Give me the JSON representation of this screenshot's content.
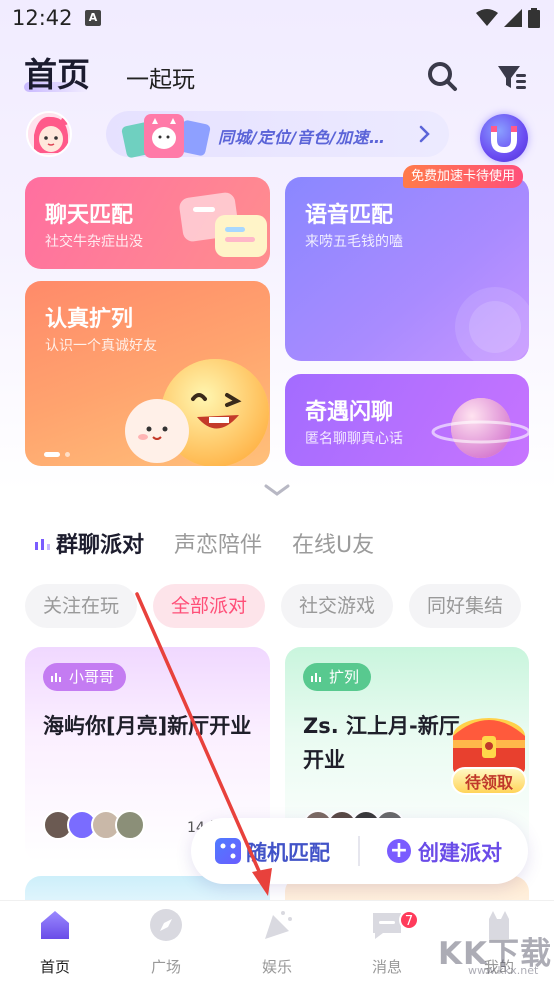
{
  "status_bar": {
    "time": "12:42",
    "notif_glyph": "A"
  },
  "header": {
    "tabs": [
      {
        "label": "首页",
        "active": true
      },
      {
        "label": "一起玩",
        "active": false
      }
    ],
    "icons": [
      "search-icon",
      "filter-icon"
    ]
  },
  "banner": {
    "text": "同城/定位/音色/加速…"
  },
  "feature_cards": {
    "chat": {
      "title": "聊天匹配",
      "subtitle": "社交牛杂症出没"
    },
    "voice": {
      "title": "语音匹配",
      "subtitle": "来唠五毛钱的嗑",
      "badge": "免费加速卡待使用"
    },
    "serious": {
      "title": "认真扩列",
      "subtitle": "认识一个真诚好友"
    },
    "flash": {
      "title": "奇遇闪聊",
      "subtitle": "匿名聊聊真心话"
    }
  },
  "section_tabs": [
    {
      "label": "群聊派对",
      "active": true
    },
    {
      "label": "声恋陪伴",
      "active": false
    },
    {
      "label": "在线U友",
      "active": false
    }
  ],
  "chips": [
    {
      "label": "关注在玩",
      "active": false
    },
    {
      "label": "全部派对",
      "active": true
    },
    {
      "label": "社交游戏",
      "active": false
    },
    {
      "label": "同好集结",
      "active": false
    }
  ],
  "rooms": [
    {
      "tag": "小哥哥",
      "title": "海屿你[月亮]新厅开业",
      "count": "14人在",
      "tag_color": "#c47cf2"
    },
    {
      "tag": "扩列",
      "title": "Zs. 江上月-新厅开业",
      "tag_color": "#58c98f"
    }
  ],
  "float_actions": {
    "random": "随机匹配",
    "create": "创建派对"
  },
  "treasure": {
    "label": "待领取"
  },
  "bottom_nav": [
    {
      "label": "首页",
      "icon": "home-icon",
      "active": true
    },
    {
      "label": "广场",
      "icon": "compass-icon",
      "active": false
    },
    {
      "label": "娱乐",
      "icon": "party-icon",
      "active": false
    },
    {
      "label": "消息",
      "icon": "message-icon",
      "active": false,
      "badge": "7"
    },
    {
      "label": "我的",
      "icon": "profile-icon",
      "active": false
    }
  ],
  "watermark": {
    "text": "KK下载",
    "sub": "www.kkx.net"
  },
  "colors": {
    "accent": "#6a4ce8",
    "chip_active": "#ff4f78",
    "arrow": "#e8413c"
  }
}
